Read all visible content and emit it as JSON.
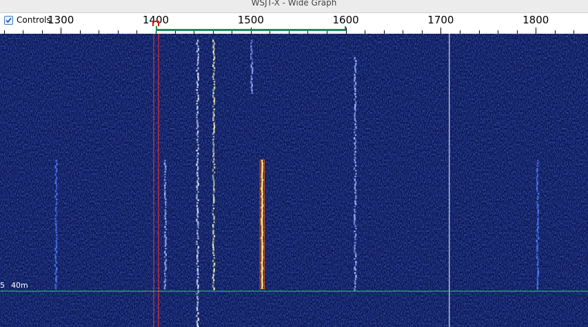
{
  "window": {
    "title": "WSJT-X - Wide Graph"
  },
  "controls": {
    "label": "Controls",
    "checked": true
  },
  "ruler": {
    "freq_min": 1236,
    "freq_max": 1855,
    "labels": [
      "1300",
      "1400",
      "1500",
      "1600",
      "1700",
      "1800"
    ],
    "passband": {
      "start": 1400,
      "end": 1600,
      "color": "#1e8a5a"
    },
    "rx_freq": 1400,
    "tx_freq": 1400
  },
  "waterfall": {
    "band": "40m",
    "edge_char": "5",
    "background": "#0a1450",
    "signals": [
      {
        "freq": 1295,
        "start": 0.43,
        "end": 0.87,
        "color": "#4d7cff"
      },
      {
        "freq": 1410,
        "start": 0.43,
        "end": 0.87,
        "color": "#9fb7ff"
      },
      {
        "freq": 1444,
        "start": 0.02,
        "end": 1.0,
        "color": "#d8e3ff"
      },
      {
        "freq": 1461,
        "start": 0.02,
        "end": 0.87,
        "color": "#e8e6a8"
      },
      {
        "freq": 1501,
        "start": 0.02,
        "end": 0.2,
        "color": "#8ea6ff"
      },
      {
        "freq": 1512,
        "start": 0.43,
        "end": 0.87,
        "color": "#ffd400"
      },
      {
        "freq": 1610,
        "start": 0.08,
        "end": 0.87,
        "color": "#9fb7ff"
      },
      {
        "freq": 1802,
        "start": 0.43,
        "end": 0.87,
        "color": "#4d7cff"
      }
    ],
    "markers": {
      "tx_line_color": "#ff3030",
      "cursor_freq": 1709,
      "cursor_color": "#ffffff",
      "band_line_color": "#2fd070"
    }
  }
}
